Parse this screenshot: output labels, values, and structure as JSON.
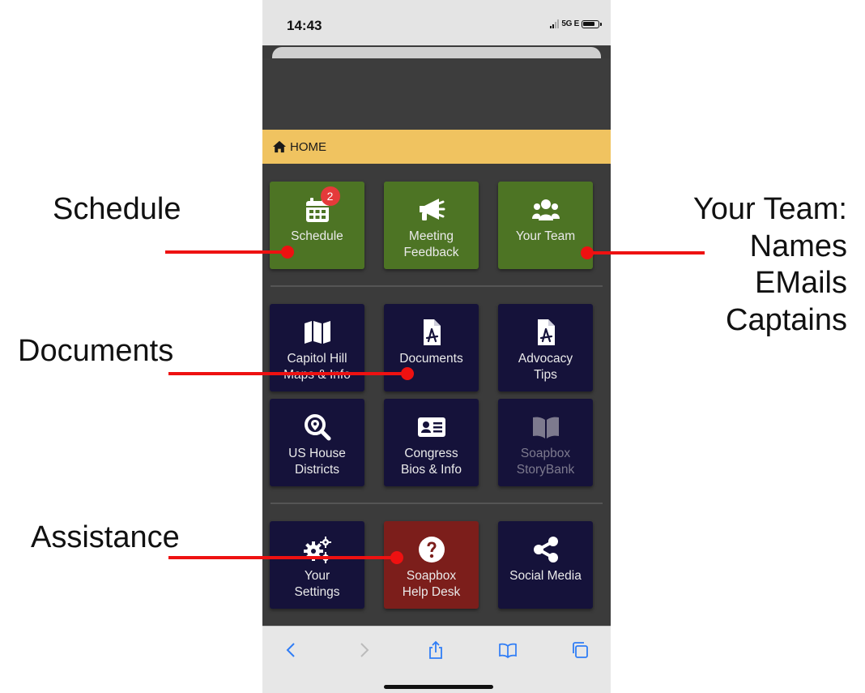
{
  "status_bar": {
    "time": "14:43",
    "network": "5G E"
  },
  "header": {
    "home_label": "HOME"
  },
  "sections": {
    "primary": [
      {
        "id": "schedule",
        "label": "Schedule",
        "icon": "calendar-icon",
        "badge": "2",
        "color": "#4d7424"
      },
      {
        "id": "meeting-feedback",
        "label": "Meeting\nFeedback",
        "icon": "megaphone-icon",
        "color": "#4d7424"
      },
      {
        "id": "your-team",
        "label": "Your Team",
        "icon": "users-icon",
        "color": "#4d7424"
      }
    ],
    "info": [
      {
        "id": "capitol-hill",
        "label": "Capitol Hill\nMaps & Info",
        "icon": "map-icon",
        "color": "#15123a"
      },
      {
        "id": "documents",
        "label": "Documents",
        "icon": "pdf-file-icon",
        "color": "#15123a"
      },
      {
        "id": "advocacy-tips",
        "label": "Advocacy\nTips",
        "icon": "pdf-file-icon",
        "color": "#15123a"
      },
      {
        "id": "us-house-districts",
        "label": "US House\nDistricts",
        "icon": "search-location-icon",
        "color": "#15123a"
      },
      {
        "id": "congress-bios",
        "label": "Congress\nBios & Info",
        "icon": "id-card-icon",
        "color": "#15123a"
      },
      {
        "id": "soapbox-storybank",
        "label": "Soapbox\nStoryBank",
        "icon": "book-open-icon",
        "color": "#15123a",
        "disabled": true
      }
    ],
    "support": [
      {
        "id": "your-settings",
        "label": "Your\nSettings",
        "icon": "gears-icon",
        "color": "#15123a"
      },
      {
        "id": "help-desk",
        "label": "Soapbox\nHelp Desk",
        "icon": "question-circle-icon",
        "color": "#7c1e1b"
      },
      {
        "id": "social-media",
        "label": "Social Media",
        "icon": "share-icon",
        "color": "#15123a"
      }
    ]
  },
  "browser_toolbar": [
    "back-icon",
    "forward-icon",
    "share-icon",
    "bookmarks-icon",
    "tabs-icon"
  ],
  "annotations": {
    "schedule": "Schedule",
    "documents": "Documents",
    "assistance": "Assistance",
    "your_team": "Your Team:\nNames\nEMails\nCaptains"
  },
  "colors": {
    "accent_bar": "#f0c360",
    "annotation_red": "#ee1111",
    "background": "#3b3b3b"
  }
}
